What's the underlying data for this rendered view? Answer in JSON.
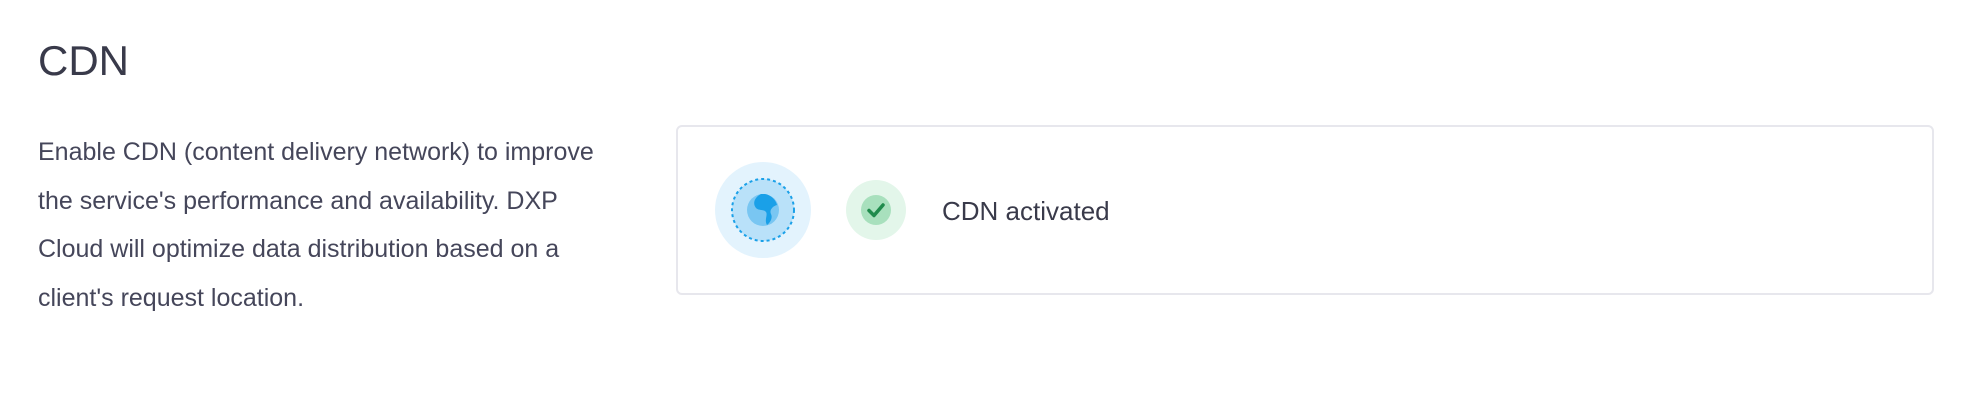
{
  "section": {
    "title": "CDN",
    "description": "Enable CDN (content delivery network) to improve the service's performance and availability. DXP Cloud will optimize data distribution based on a client's request location."
  },
  "status_card": {
    "icon": "globe-icon",
    "status_icon": "check-circle-icon",
    "status_text": "CDN activated"
  },
  "colors": {
    "globe_bg_outer": "#e3f3fd",
    "globe_accent": "#1aa0e8",
    "success_bg": "#e3f6ea",
    "success_accent": "#1f8b4c",
    "card_border": "#e7e7ed",
    "text": "#393a4a"
  }
}
